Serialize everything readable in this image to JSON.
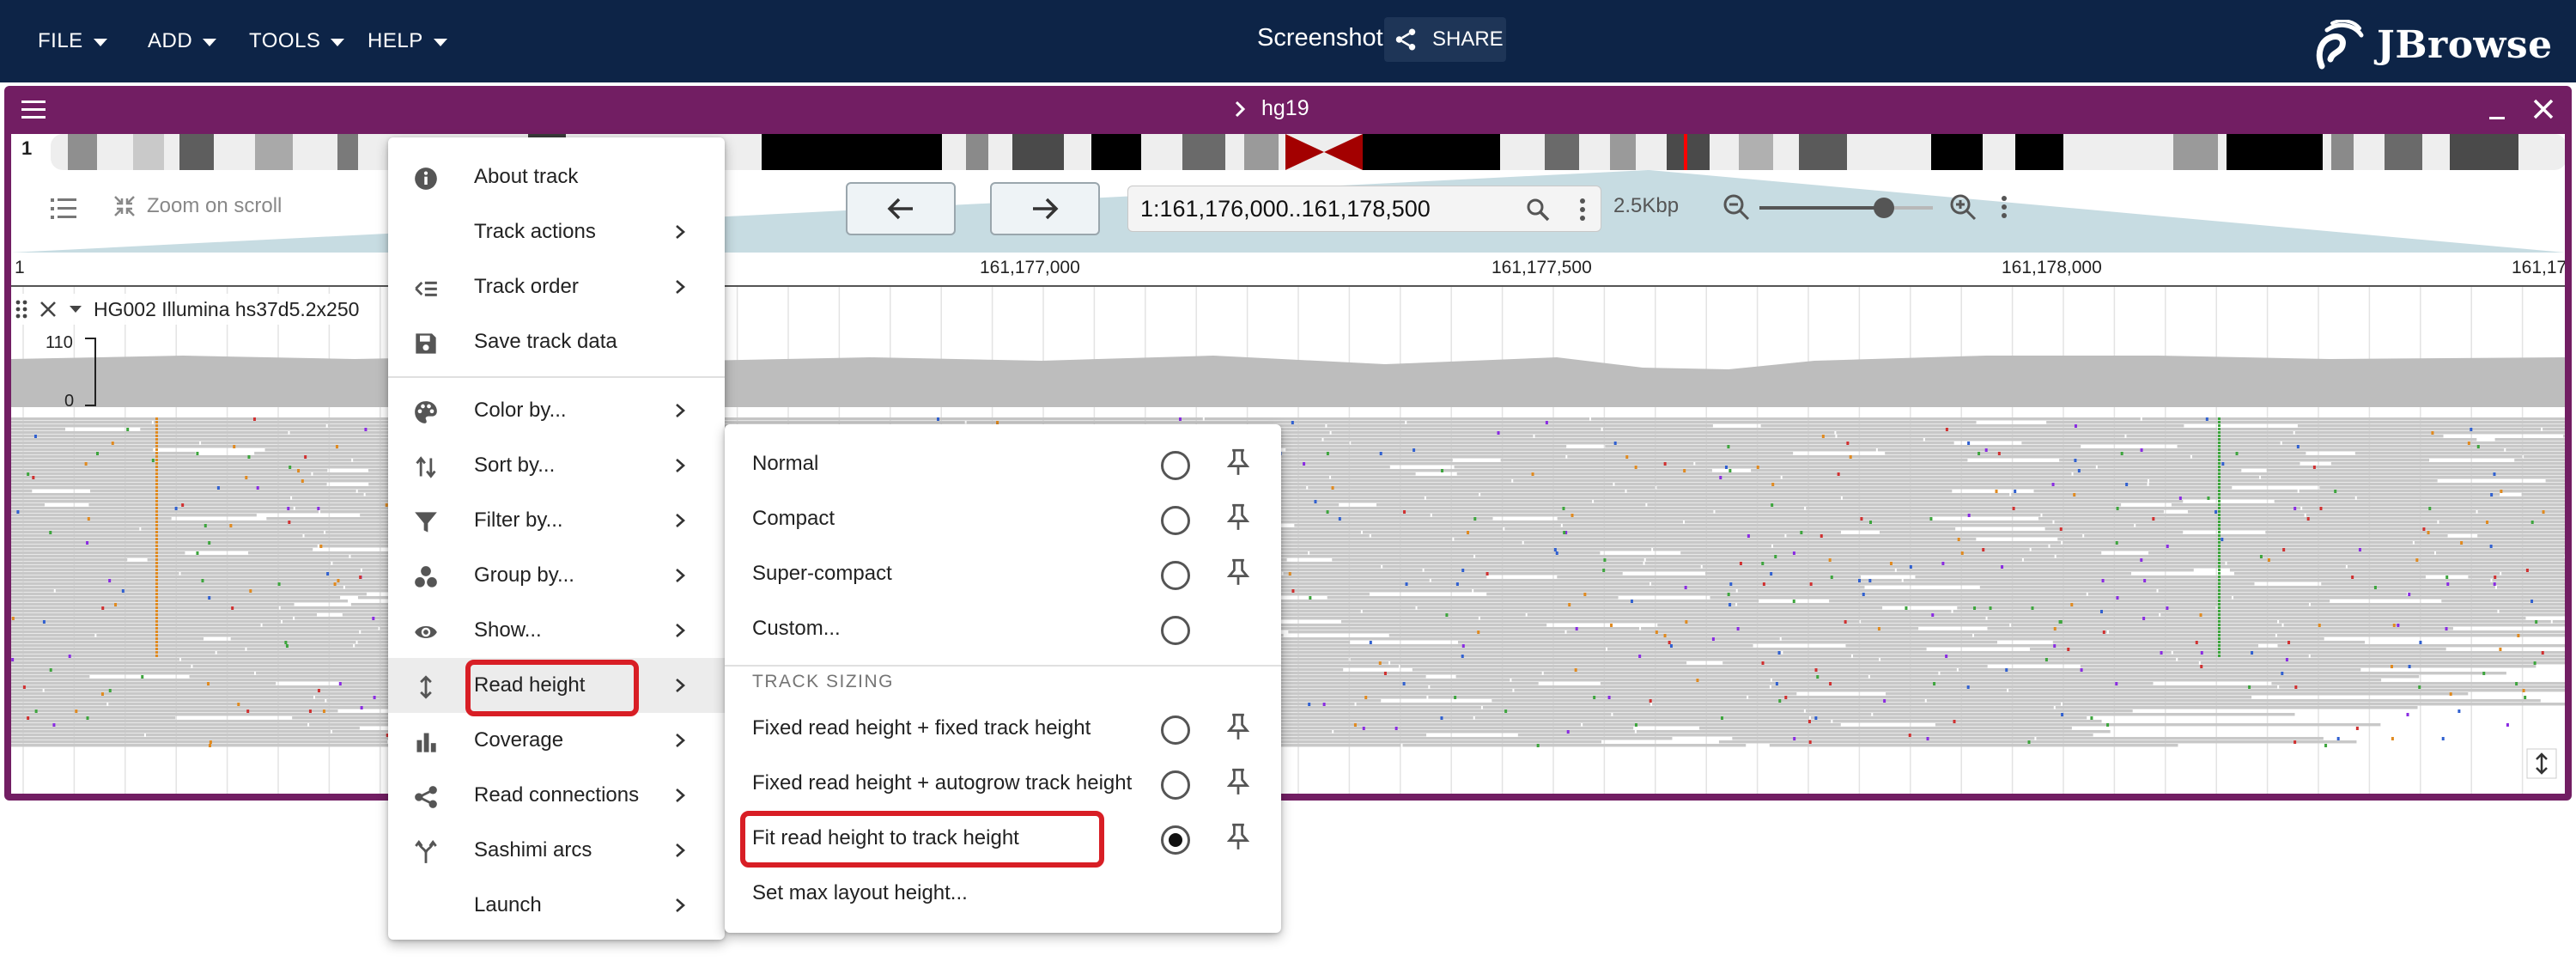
{
  "topbar": {
    "menus": [
      "FILE",
      "ADD",
      "TOOLS",
      "HELP"
    ],
    "session_name": "Screenshot",
    "share_label": "SHARE",
    "logo_text": "JBrowse"
  },
  "view": {
    "assembly": "hg19",
    "chromosome": "1",
    "zoom_on_scroll": "Zoom on scroll",
    "location": "1:161,176,000..161,178,500",
    "bp_per_view": "2.5Kbp",
    "zoom_level": 0.72,
    "ruler_start": "1",
    "ruler_ticks": [
      "161,177,000",
      "161,177,500",
      "161,178,000",
      "161,17"
    ]
  },
  "track": {
    "name": "HG002 Illumina hs37d5.2x250",
    "coverage_max": "110",
    "coverage_min": "0"
  },
  "track_menu": {
    "items": [
      {
        "label": "About track",
        "icon": "info-icon",
        "submenu": false
      },
      {
        "label": "Track actions",
        "icon": "",
        "submenu": true
      },
      {
        "label": "Track order",
        "icon": "track-order-icon",
        "submenu": true
      },
      {
        "label": "Save track data",
        "icon": "save-icon",
        "submenu": false
      },
      {
        "label": "Color by...",
        "icon": "palette-icon",
        "submenu": true
      },
      {
        "label": "Sort by...",
        "icon": "sort-icon",
        "submenu": true
      },
      {
        "label": "Filter by...",
        "icon": "filter-icon",
        "submenu": true
      },
      {
        "label": "Group by...",
        "icon": "group-icon",
        "submenu": true
      },
      {
        "label": "Show...",
        "icon": "eye-icon",
        "submenu": true
      },
      {
        "label": "Read height",
        "icon": "vertical-arrows-icon",
        "submenu": true
      },
      {
        "label": "Coverage",
        "icon": "bar-chart-icon",
        "submenu": true
      },
      {
        "label": "Read connections",
        "icon": "share-icon",
        "submenu": true
      },
      {
        "label": "Sashimi arcs",
        "icon": "fork-icon",
        "submenu": true
      },
      {
        "label": "Launch",
        "icon": "",
        "submenu": true
      }
    ]
  },
  "read_height_menu": {
    "items": [
      {
        "label": "Normal",
        "selected": false,
        "pin": true
      },
      {
        "label": "Compact",
        "selected": false,
        "pin": true
      },
      {
        "label": "Super-compact",
        "selected": false,
        "pin": true
      },
      {
        "label": "Custom...",
        "selected": false,
        "pin": false
      }
    ],
    "section_header": "TRACK SIZING",
    "sizing_items": [
      {
        "label": "Fixed read height + fixed track height",
        "selected": false,
        "pin": true
      },
      {
        "label": "Fixed read height + autogrow track height",
        "selected": false,
        "pin": true
      },
      {
        "label": "Fit read height to track height",
        "selected": true,
        "pin": true
      }
    ],
    "max_layout_label": "Set max layout height..."
  },
  "colors": {
    "topbar": "#0d2447",
    "view_border": "#721e63",
    "highlight_box": "#d81e25",
    "read_gray": "#c8c8c8"
  }
}
